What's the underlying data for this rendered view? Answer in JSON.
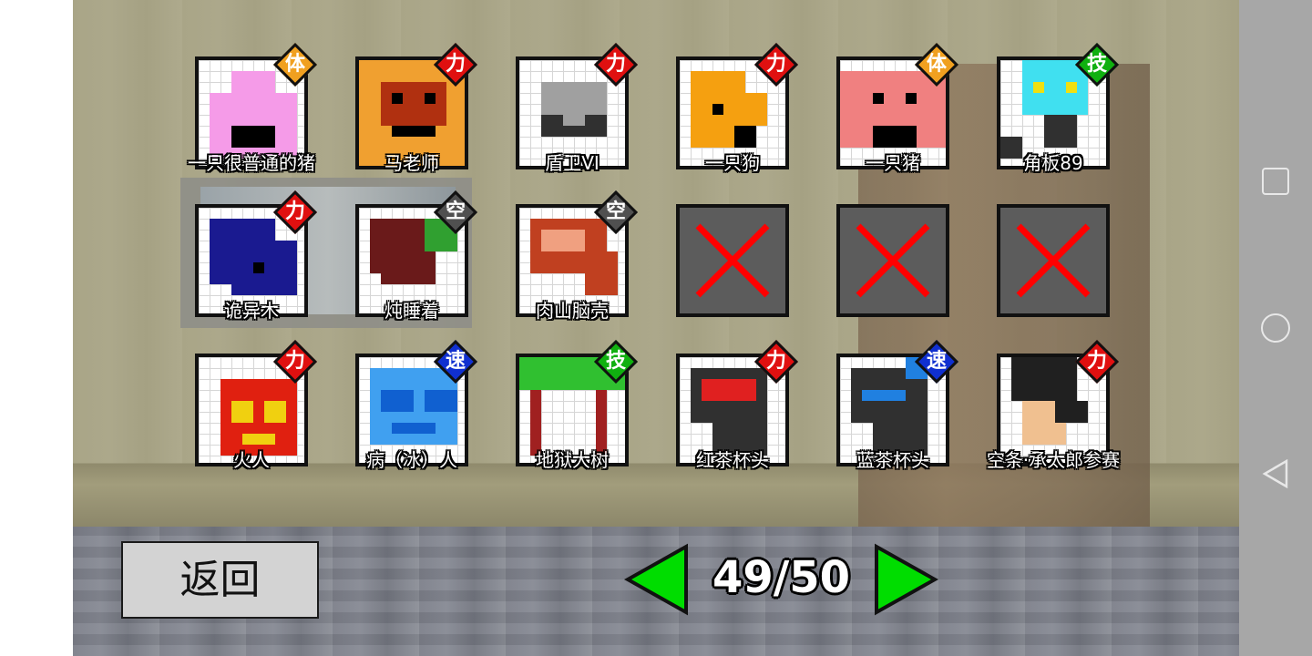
{
  "roster": {
    "cards": [
      {
        "name": "一只很普通的猪",
        "type": "体",
        "type_color": "#f0a020",
        "art": "pig-icon",
        "palette": [
          "#f59be8",
          "#000000"
        ]
      },
      {
        "name": "马老师",
        "type": "力",
        "type_color": "#e01010",
        "art": "master-ma-icon",
        "palette": [
          "#f0a030",
          "#b03010",
          "#000000"
        ]
      },
      {
        "name": "盾卫VI",
        "type": "力",
        "type_color": "#e01010",
        "art": "shield-guard-icon",
        "palette": [
          "#a0a0a0",
          "#303030"
        ]
      },
      {
        "name": "一只狗",
        "type": "力",
        "type_color": "#e01010",
        "art": "dog-icon",
        "palette": [
          "#f5a010",
          "#000000"
        ]
      },
      {
        "name": "一只猪",
        "type": "体",
        "type_color": "#f0a020",
        "art": "pig-face-icon",
        "palette": [
          "#f08080",
          "#000000"
        ]
      },
      {
        "name": "角板89",
        "type": "技",
        "type_color": "#10b010",
        "art": "robot-icon",
        "palette": [
          "#40e0f0",
          "#f0e010",
          "#303030"
        ]
      },
      {
        "name": "诡异木",
        "type": "力",
        "type_color": "#e01010",
        "art": "weird-tree-icon",
        "palette": [
          "#1a1a90",
          "#000000"
        ]
      },
      {
        "name": "炖睡着",
        "type": "空",
        "type_color": "#505050",
        "art": "sleeping-beast-icon",
        "palette": [
          "#6a1a1a",
          "#30a030"
        ]
      },
      {
        "name": "肉山脑壳",
        "type": "空",
        "type_color": "#505050",
        "art": "meat-head-icon",
        "palette": [
          "#c04020",
          "#f0a080"
        ]
      },
      {
        "name": "",
        "type": "",
        "type_color": "",
        "art": "locked-x-icon",
        "palette": [
          "#ff0000"
        ]
      },
      {
        "name": "",
        "type": "",
        "type_color": "",
        "art": "locked-x-icon",
        "palette": [
          "#ff0000"
        ]
      },
      {
        "name": "",
        "type": "",
        "type_color": "",
        "art": "locked-x-icon",
        "palette": [
          "#ff0000"
        ]
      },
      {
        "name": "火人",
        "type": "力",
        "type_color": "#e01010",
        "art": "fire-man-icon",
        "palette": [
          "#e02010",
          "#f0d010"
        ]
      },
      {
        "name": "病（冰）人",
        "type": "速",
        "type_color": "#1030d0",
        "art": "ice-man-icon",
        "palette": [
          "#40a0f0",
          "#1060d0"
        ]
      },
      {
        "name": "地狱大树",
        "type": "技",
        "type_color": "#10b010",
        "art": "hell-tree-icon",
        "palette": [
          "#30c030",
          "#a02020"
        ]
      },
      {
        "name": "红茶杯头",
        "type": "力",
        "type_color": "#e01010",
        "art": "red-cuphead-icon",
        "palette": [
          "#303030",
          "#e02020"
        ]
      },
      {
        "name": "蓝茶杯头",
        "type": "速",
        "type_color": "#1030d0",
        "art": "blue-cuphead-icon",
        "palette": [
          "#303030",
          "#2080e0"
        ]
      },
      {
        "name": "空条·承太郎参赛",
        "type": "力",
        "type_color": "#e01010",
        "art": "jotaro-icon",
        "palette": [
          "#202020",
          "#f0c090"
        ]
      }
    ]
  },
  "footer": {
    "back_label": "返回",
    "page": "49/50",
    "arrow_color": "#00dd00"
  }
}
